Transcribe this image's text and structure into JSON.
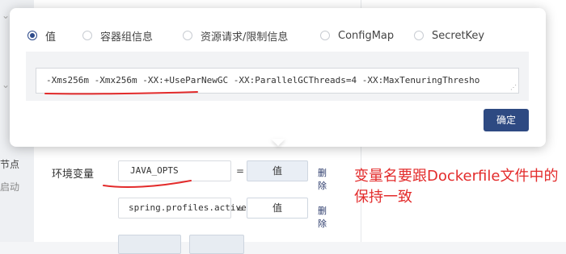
{
  "background": {
    "sidebar_labels": [
      "节点",
      "启动"
    ],
    "env_label": "环境变量",
    "rows": [
      {
        "name": "JAVA_OPTS",
        "eq": "=",
        "value_label": "值",
        "delete_label": "删除"
      },
      {
        "name": "spring.profiles.active",
        "eq": "=",
        "value_label": "值",
        "delete_label": "删除"
      }
    ]
  },
  "annotation": {
    "text": "变量名要跟Dockerfile文件中的保持一致",
    "color": "#e32b2b"
  },
  "modal": {
    "tabs": [
      {
        "label": "值",
        "selected": true
      },
      {
        "label": "容器组信息",
        "selected": false
      },
      {
        "label": "资源请求/限制信息",
        "selected": false
      },
      {
        "label": "ConfigMap",
        "selected": false
      },
      {
        "label": "SecretKey",
        "selected": false
      }
    ],
    "value_text": "-Xms256m -Xmx256m -XX:+UseParNewGC -XX:ParallelGCThreads=4 -XX:MaxTenuringThresho",
    "confirm_label": "确定"
  },
  "colors": {
    "primary": "#2e4a82",
    "annotation": "#e32b2b",
    "panel_bg": "#f2f3f5"
  }
}
